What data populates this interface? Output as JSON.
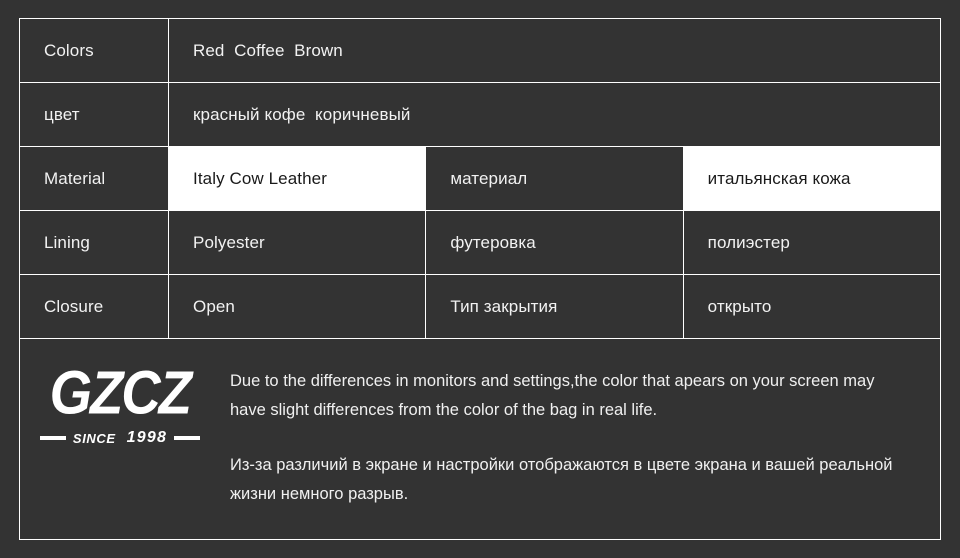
{
  "theme": {
    "background": "#333333",
    "border": "#ffffff",
    "text": "#f2f2f2",
    "highlight_bg": "#ffffff",
    "highlight_text": "#1a1a1a"
  },
  "spec_table": {
    "rows": [
      {
        "label": "Colors",
        "value": "Red  Coffee  Brown",
        "merged": true,
        "highlight": false
      },
      {
        "label": "цвет",
        "value": "красный кофе  коричневый",
        "merged": true,
        "highlight": false
      },
      {
        "label": "Material",
        "value": "Italy Cow Leather",
        "ru_label": "материал",
        "ru_value": "итальянская кожа",
        "merged": false,
        "highlight": true
      },
      {
        "label": "Lining",
        "value": "Polyester",
        "ru_label": "футеровка",
        "ru_value": "полиэстер",
        "merged": false,
        "highlight": false
      },
      {
        "label": "Closure",
        "value": "Open",
        "ru_label": "Тип закрытия",
        "ru_value": "открыто",
        "merged": false,
        "highlight": false
      }
    ]
  },
  "disclaimer": {
    "logo": {
      "mark": "GZCZ",
      "since_label": "SINCE",
      "year": "1998"
    },
    "notes": [
      "Due to the differences in monitors and settings,the color that apears on your screen may have slight differences from the color of the bag in real life.",
      "Из-за различий в экране и настройки отображаются в цвете экрана и вашей реальной жизни немного разрыв."
    ]
  }
}
